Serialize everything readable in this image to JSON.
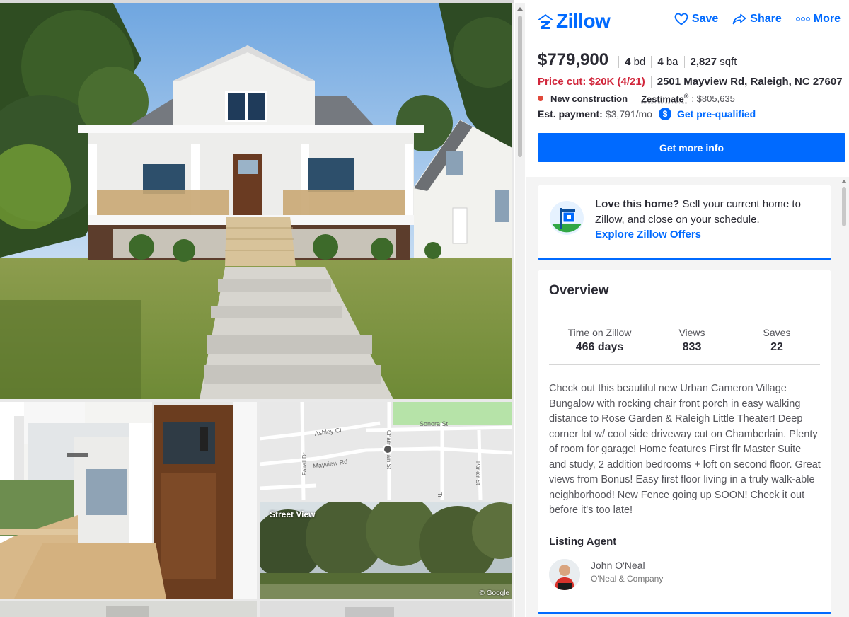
{
  "brand": {
    "name": "Zillow",
    "accent": "#006aff"
  },
  "actions": [
    {
      "label": "Save",
      "icon": "heart-icon"
    },
    {
      "label": "Share",
      "icon": "share-arrow-icon"
    },
    {
      "label": "More",
      "icon": "ellipsis-icon"
    }
  ],
  "listing": {
    "price": "$779,900",
    "beds": "4",
    "beds_unit": "bd",
    "baths": "4",
    "baths_unit": "ba",
    "sqft": "2,827",
    "sqft_unit": "sqft",
    "price_cut": "Price cut: $20K (4/21)",
    "address": "2501 Mayview Rd, Raleigh, NC 27607",
    "status": "New construction",
    "status_color": "#e0483a",
    "zestimate_label": "Zestimate",
    "zestimate_mark": "®",
    "zestimate_value": ": $805,635",
    "payment_label": "Est. payment:",
    "payment_value": "$3,791/mo",
    "payment_icon": "$",
    "prequal_link": "Get pre-qualified",
    "cta": "Get more info"
  },
  "offers": {
    "lead": "Love this home?",
    "text": " Sell your current home to Zillow, and close on your schedule.",
    "link": "Explore Zillow Offers"
  },
  "overview": {
    "title": "Overview",
    "stats": [
      {
        "label": "Time on Zillow",
        "value": "466 days"
      },
      {
        "label": "Views",
        "value": "833"
      },
      {
        "label": "Saves",
        "value": "22"
      }
    ],
    "description": "Check out this beautiful new Urban Cameron Village Bungalow with rocking chair front porch in easy walking distance to Rose Garden & Raleigh Little Theater! Deep corner lot w/ cool side driveway cut on Chamberlain. Plenty of room for garage!  Home features First flr Master Suite and study, 2 addition bedrooms + loft on second floor. Great views from Bonus! Easy first floor living in a truly walk-able neighborhood! New Fence going up SOON! Check it out before it's too late!",
    "agent_title": "Listing Agent",
    "agent_name": "John O'Neal",
    "agent_company": "O'Neal & Company"
  },
  "map": {
    "streets": [
      "Ashley Ct",
      "Sonora St",
      "Mayview Rd",
      "Chamberlain St",
      "Parker St",
      "Fairall Dr",
      "Tr"
    ]
  },
  "gallery": {
    "street_view_label": "Street View",
    "credit": "© Google"
  }
}
